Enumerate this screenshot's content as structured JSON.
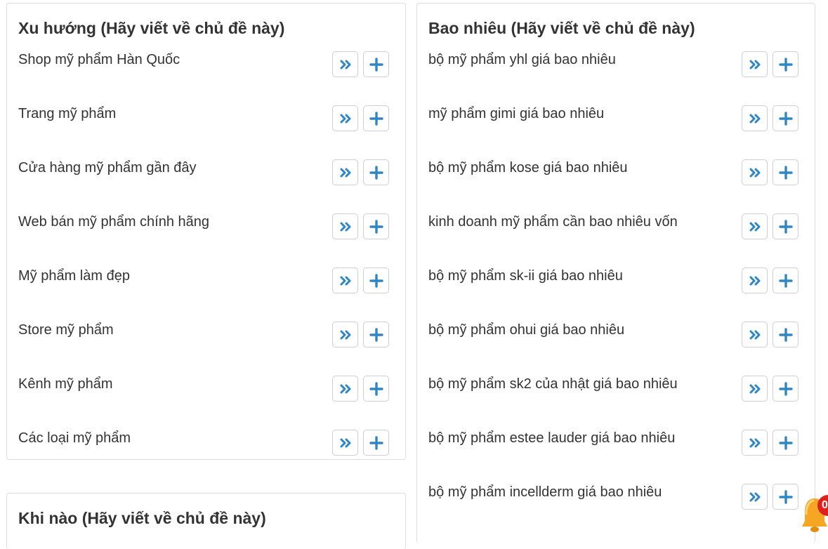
{
  "cards": {
    "xu_huong": {
      "title": "Xu hướng (Hãy viết về chủ đề này)",
      "items": [
        "Shop mỹ phẩm Hàn Quốc",
        "Trang mỹ phẩm",
        "Cửa hàng mỹ phẩm gần đây",
        "Web bán mỹ phẩm chính hãng",
        "Mỹ phẩm làm đẹp",
        "Store mỹ phẩm",
        "Kênh mỹ phẩm",
        "Các loại mỹ phẩm"
      ]
    },
    "bao_nhieu": {
      "title": "Bao nhiêu (Hãy viết về chủ đề này)",
      "items": [
        "bộ mỹ phẩm yhl giá bao nhiêu",
        "mỹ phẩm gimi giá bao nhiêu",
        "bộ mỹ phẩm kose giá bao nhiêu",
        "kinh doanh mỹ phẩm cần bao nhiêu vốn",
        "bộ mỹ phẩm sk-ii giá bao nhiêu",
        "bộ mỹ phẩm ohui giá bao nhiêu",
        "bộ mỹ phẩm sk2 của nhật giá bao nhiêu",
        "bộ mỹ phẩm estee lauder giá bao nhiêu",
        "bộ mỹ phẩm incellderm giá bao nhiêu"
      ]
    },
    "khi_nao": {
      "title": "Khi nào (Hãy viết về chủ đề này)"
    }
  },
  "icons": {
    "row_action_primary": "double-chevron-right-icon",
    "row_action_secondary": "plus-icon",
    "notification": "bell-icon"
  },
  "notification": {
    "badge": "0"
  },
  "colors": {
    "icon_blue": "#2f86c4",
    "border": "#dcdcdc",
    "text": "#333333",
    "bell": "#f5a623",
    "badge": "#e02020"
  }
}
